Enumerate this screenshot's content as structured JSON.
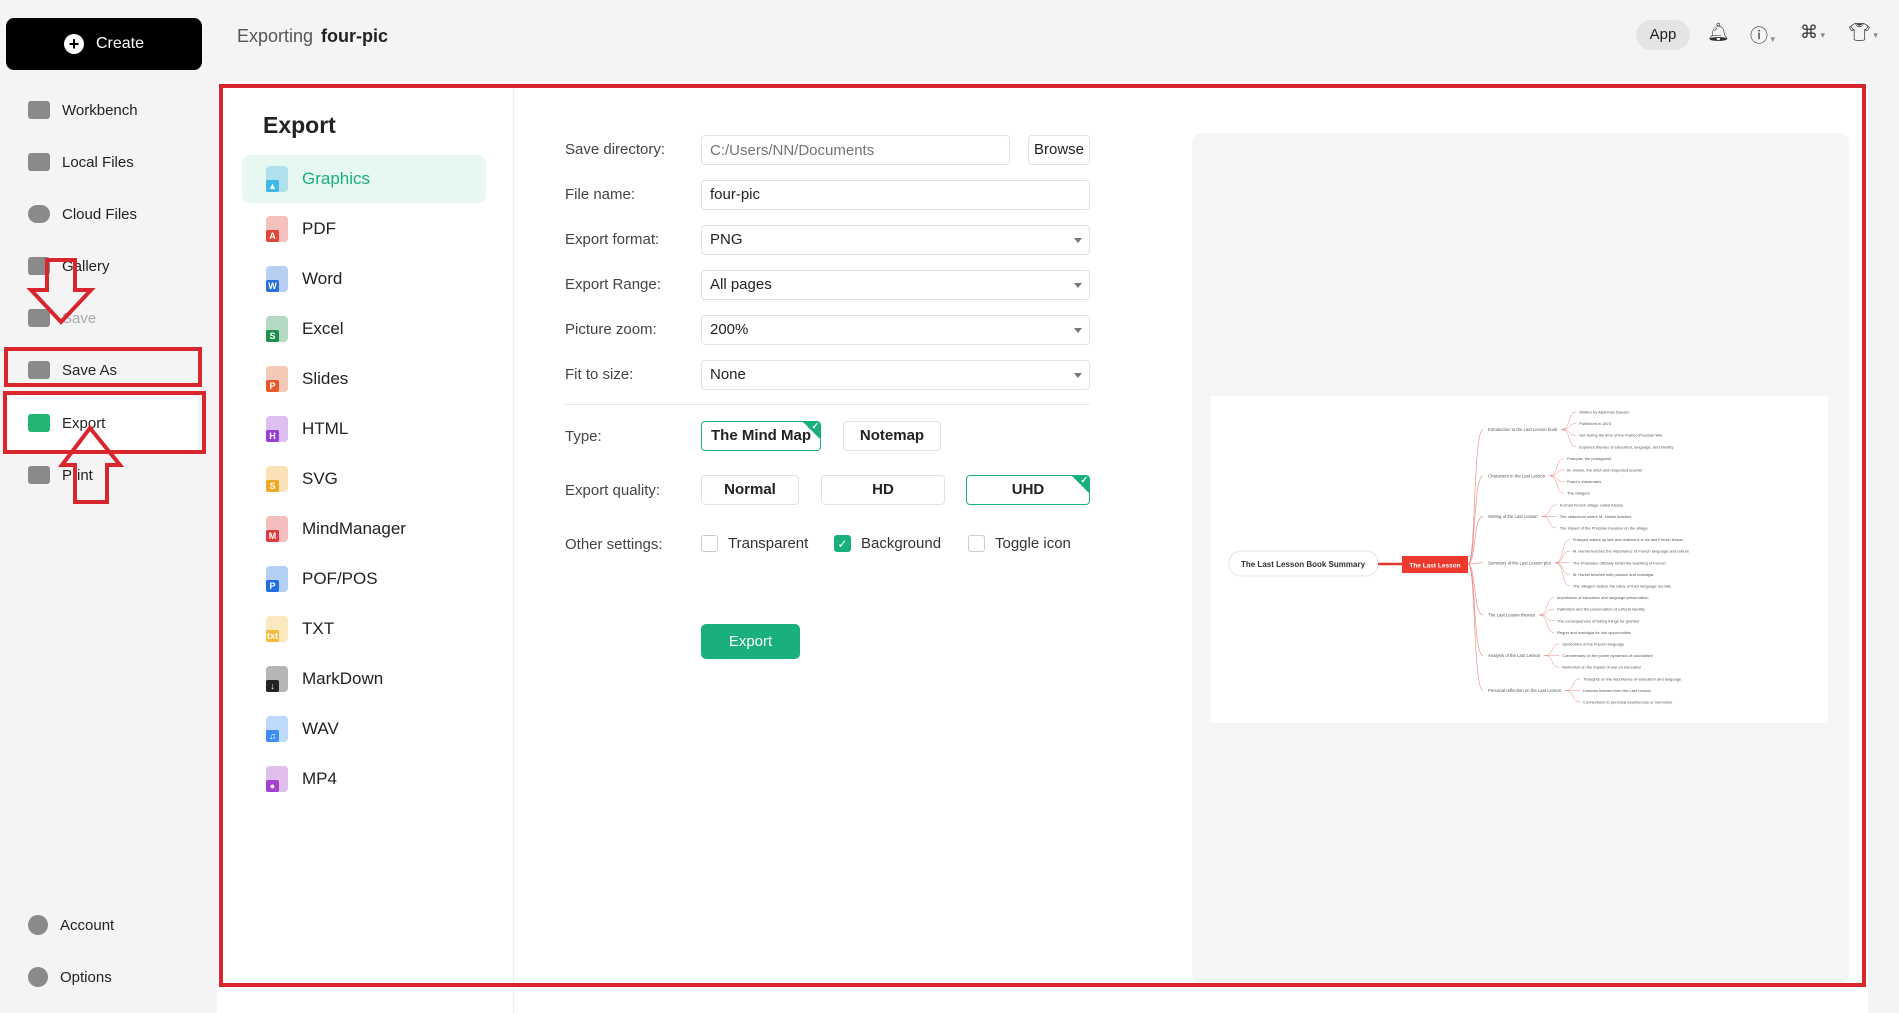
{
  "sidebar": {
    "create_label": "Create",
    "items": [
      {
        "label": "Workbench"
      },
      {
        "label": "Local Files"
      },
      {
        "label": "Cloud Files"
      },
      {
        "label": "Gallery"
      },
      {
        "label": "Save"
      },
      {
        "label": "Save As"
      },
      {
        "label": "Export"
      },
      {
        "label": "Print"
      }
    ],
    "bottom": [
      {
        "label": "Account"
      },
      {
        "label": "Options"
      }
    ]
  },
  "header": {
    "prefix": "Exporting",
    "filename": "four-pic",
    "app_label": "App",
    "icons": [
      "bell-icon",
      "help-icon",
      "apps-icon",
      "shirt-icon"
    ]
  },
  "export": {
    "title": "Export",
    "formats": [
      {
        "label": "Graphics",
        "color": "#3fb8e8",
        "badge": "▲"
      },
      {
        "label": "PDF",
        "color": "#e0453a",
        "badge": "A"
      },
      {
        "label": "Word",
        "color": "#2a6fdb",
        "badge": "W"
      },
      {
        "label": "Excel",
        "color": "#1d8f4e",
        "badge": "S"
      },
      {
        "label": "Slides",
        "color": "#e55a2b",
        "badge": "P"
      },
      {
        "label": "HTML",
        "color": "#9a3fd6",
        "badge": "H"
      },
      {
        "label": "SVG",
        "color": "#f0a824",
        "badge": "S"
      },
      {
        "label": "MindManager",
        "color": "#e03a3a",
        "badge": "M"
      },
      {
        "label": "POF/POS",
        "color": "#1f6fe0",
        "badge": "P"
      },
      {
        "label": "TXT",
        "color": "#f4bb3a",
        "badge": "txt"
      },
      {
        "label": "MarkDown",
        "color": "#222222",
        "badge": "↓"
      },
      {
        "label": "WAV",
        "color": "#3d8ef0",
        "badge": "♫"
      },
      {
        "label": "MP4",
        "color": "#a340d0",
        "badge": "●"
      }
    ],
    "selected": "Graphics",
    "form": {
      "save_directory_label": "Save directory:",
      "save_directory_placeholder": "C:/Users/NN/Documents",
      "browse_label": "Browse",
      "file_name_label": "File name:",
      "file_name": "four-pic",
      "export_format_label": "Export format:",
      "export_format": "PNG",
      "export_range_label": "Export Range:",
      "export_range": "All pages",
      "picture_zoom_label": "Picture zoom:",
      "picture_zoom": "200%",
      "fit_label": "Fit to size:",
      "fit": "None",
      "type_label": "Type:",
      "types": [
        "The Mind Map",
        "Notemap"
      ],
      "type_selected": "The Mind Map",
      "quality_label": "Export quality:",
      "qualities": [
        "Normal",
        "HD",
        "UHD"
      ],
      "quality_selected": "UHD",
      "other_label": "Other settings:",
      "transparent_label": "Transparent",
      "transparent": false,
      "background_label": "Background",
      "background": true,
      "toggle_icon_label": "Toggle icon",
      "toggle_icon": false,
      "export_button": "Export"
    }
  },
  "accent": "#19b07c",
  "highlight_color": "#d9262e",
  "mindmap": {
    "root": "The Last Lesson Book Summary",
    "central": "The Last Lesson",
    "branches": [
      {
        "label": "Introduction to the Last Lesson book",
        "children": [
          "Written by Alphonse Daudet",
          "Published in 1873",
          "Set during the time of the Franco-Prussian War",
          "Explores themes of education, language, and identity"
        ]
      },
      {
        "label": "Characters in the Last Lesson",
        "children": [
          "François, the protagonist",
          "M. Hamel, the strict and respected teacher",
          "Franz's classmates",
          "The villagers"
        ]
      },
      {
        "label": "Setting of the Last Lesson",
        "children": [
          "A small French village called Alsace",
          "The classroom where M. Hamel teaches",
          "The impact of the Prussian invasion on the village"
        ]
      },
      {
        "label": "Summary of the Last Lesson plot",
        "children": [
          "François wakes up late and realizes it is his last French lesson",
          "M. Hamel teaches the importance of French language and culture",
          "The Prussians officially forbid the teaching of French",
          "M. Hamel teaches with passion and nostalgia",
          "The villagers realize the value of their language too late"
        ]
      },
      {
        "label": "The Last Lesson themes",
        "children": [
          "Importance of education and language preservation",
          "Patriotism and the preservation of cultural identity",
          "The consequences of taking things for granted",
          "Regret and nostalgia for lost opportunities"
        ]
      },
      {
        "label": "Analysis of the Last Lesson",
        "children": [
          "Symbolism of the French language",
          "Commentary on the power dynamics of colonialism",
          "Reflection on the impact of war on education"
        ]
      },
      {
        "label": "Personal reflection on the Last Lesson",
        "children": [
          "Thoughts on the importance of education and language",
          "Lessons learned from the Last Lesson",
          "Connections to personal experiences or memories"
        ]
      }
    ]
  }
}
